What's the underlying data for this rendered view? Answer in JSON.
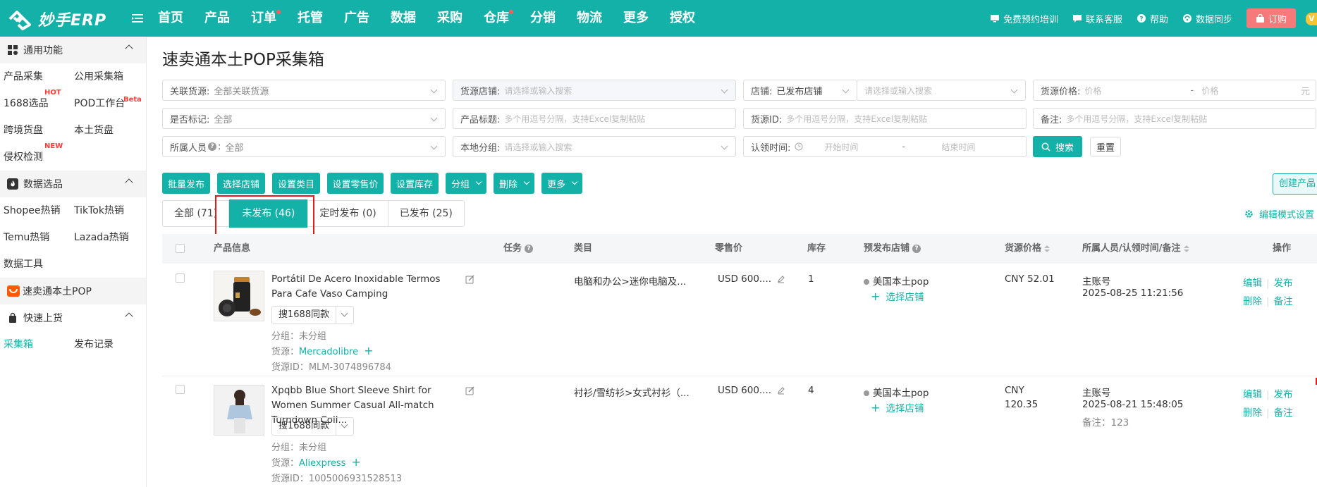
{
  "app": {
    "name": "妙手ERP"
  },
  "nav": {
    "items": [
      "首页",
      "产品",
      "订单",
      "托管",
      "广告",
      "数据",
      "采购",
      "仓库",
      "分销",
      "物流",
      "更多",
      "授权"
    ]
  },
  "toplinks": {
    "training": "免费预约培训",
    "service": "联系客服",
    "help": "帮助",
    "sync": "数据同步",
    "order": "订购",
    "vip": "V"
  },
  "sidebar": {
    "sections": [
      {
        "title": "通用功能",
        "items": [
          {
            "label": "产品采集"
          },
          {
            "label": "公用采集箱"
          },
          {
            "label": "1688选品",
            "badge": "HOT"
          },
          {
            "label": "POD工作台",
            "badge": "Beta"
          },
          {
            "label": "跨境货盘"
          },
          {
            "label": "本土货盘"
          },
          {
            "label": "侵权检测",
            "badge": "NEW"
          }
        ]
      },
      {
        "title": "数据选品",
        "items": [
          {
            "label": "Shopee热销"
          },
          {
            "label": "TikTok热销"
          },
          {
            "label": "Temu热销"
          },
          {
            "label": "Lazada热销"
          },
          {
            "label": "数据工具"
          }
        ]
      },
      {
        "title": "快速上货",
        "items": [
          {
            "label": "采集箱"
          },
          {
            "label": "发布记录"
          }
        ]
      }
    ],
    "pop_item": "速卖通本土POP"
  },
  "page": {
    "title": "速卖通本土POP采集箱"
  },
  "filters": {
    "linked_source": {
      "label": "关联货源:",
      "value": "全部关联货源"
    },
    "source_store": {
      "label": "货源店铺:",
      "placeholder": "请选择或输入搜索"
    },
    "store": {
      "label": "店铺:",
      "value": "已发布店铺",
      "placeholder": "请选择或输入搜索"
    },
    "source_price": {
      "label": "货源价格:",
      "min_placeholder": "价格",
      "dash": "-",
      "max_placeholder": "价格",
      "unit": "元"
    },
    "marked": {
      "label": "是否标记:",
      "value": "全部"
    },
    "product_title": {
      "label": "产品标题:",
      "placeholder": "多个用逗号分隔，支持Excel复制粘贴"
    },
    "source_id": {
      "label": "货源ID:",
      "placeholder": "多个用逗号分隔，支持Excel复制粘贴"
    },
    "remark": {
      "label": "备注:",
      "placeholder": "多个用逗号分隔，支持Excel复制粘贴"
    },
    "owner": {
      "label": "所属人员",
      "value": "全部"
    },
    "local_group": {
      "label": "本地分组:",
      "placeholder": "请选择或输入搜索"
    },
    "claim_time": {
      "label": "认领时间:",
      "start": "开始时间",
      "dash": "-",
      "end": "结束时间"
    },
    "search_label": "搜索",
    "reset_label": "重置"
  },
  "actions": {
    "batch_publish": "批量发布",
    "select_store": "选择店铺",
    "set_category": "设置类目",
    "set_price": "设置零售价",
    "set_stock": "设置库存",
    "group": "分组",
    "delete": "删除",
    "more": "更多",
    "create": "创建产品"
  },
  "tabs": [
    {
      "label": "全部 (71)"
    },
    {
      "label": "未发布 (46)"
    },
    {
      "label": "定时发布 (0)"
    },
    {
      "label": "已发布 (25)"
    }
  ],
  "edit_mode": "编辑模式设置",
  "table": {
    "headers": {
      "product": "产品信息",
      "task": "任务",
      "category": "类目",
      "price": "零售价",
      "stock": "库存",
      "store": "预发布店铺",
      "source_price": "货源价格",
      "owner": "所属人员/认领时间/备注",
      "ops": "操作"
    },
    "rows": [
      {
        "title": "Portátil De Acero Inoxidable Termos Para Cafe Vaso Camping",
        "search1688": "搜1688同款",
        "group": "分组：未分组",
        "source_label": "货源：",
        "source": "Mercadolibre",
        "source_id": "货源ID：MLM-3074896784",
        "category": "电脑和办公>迷你电脑及...",
        "price": "USD 600....",
        "stock": "1",
        "store": "美国本土pop",
        "select_store": "选择店铺",
        "source_price_line1": "CNY 52.01",
        "source_price_line2": "",
        "owner": "主账号",
        "time": "2025-08-25 11:21:56",
        "remark": "",
        "ops": [
          "编辑",
          "发布",
          "删除",
          "备注"
        ]
      },
      {
        "title": "Xpqbb Blue Short Sleeve Shirt for Women Summer Casual All-match Turndown Coll...",
        "search1688": "搜1688同款",
        "group": "分组：未分组",
        "source_label": "货源：",
        "source": "Aliexpress",
        "source_id": "货源ID：1005006931528513",
        "category": "衬衫/雪纺衫>女式衬衫（...",
        "price": "USD 600....",
        "stock": "4",
        "store": "美国本土pop",
        "select_store": "选择店铺",
        "source_price_line1": "CNY",
        "source_price_line2": "120.35",
        "owner": "主账号",
        "time": "2025-08-21 15:48:05",
        "remark": "备注：123",
        "ops": [
          "编辑",
          "发布",
          "删除",
          "备注"
        ]
      }
    ]
  },
  "colors": {
    "brand": "#14b1a8",
    "highlight": "#e51b1b",
    "badge": "#ff3b3b"
  }
}
